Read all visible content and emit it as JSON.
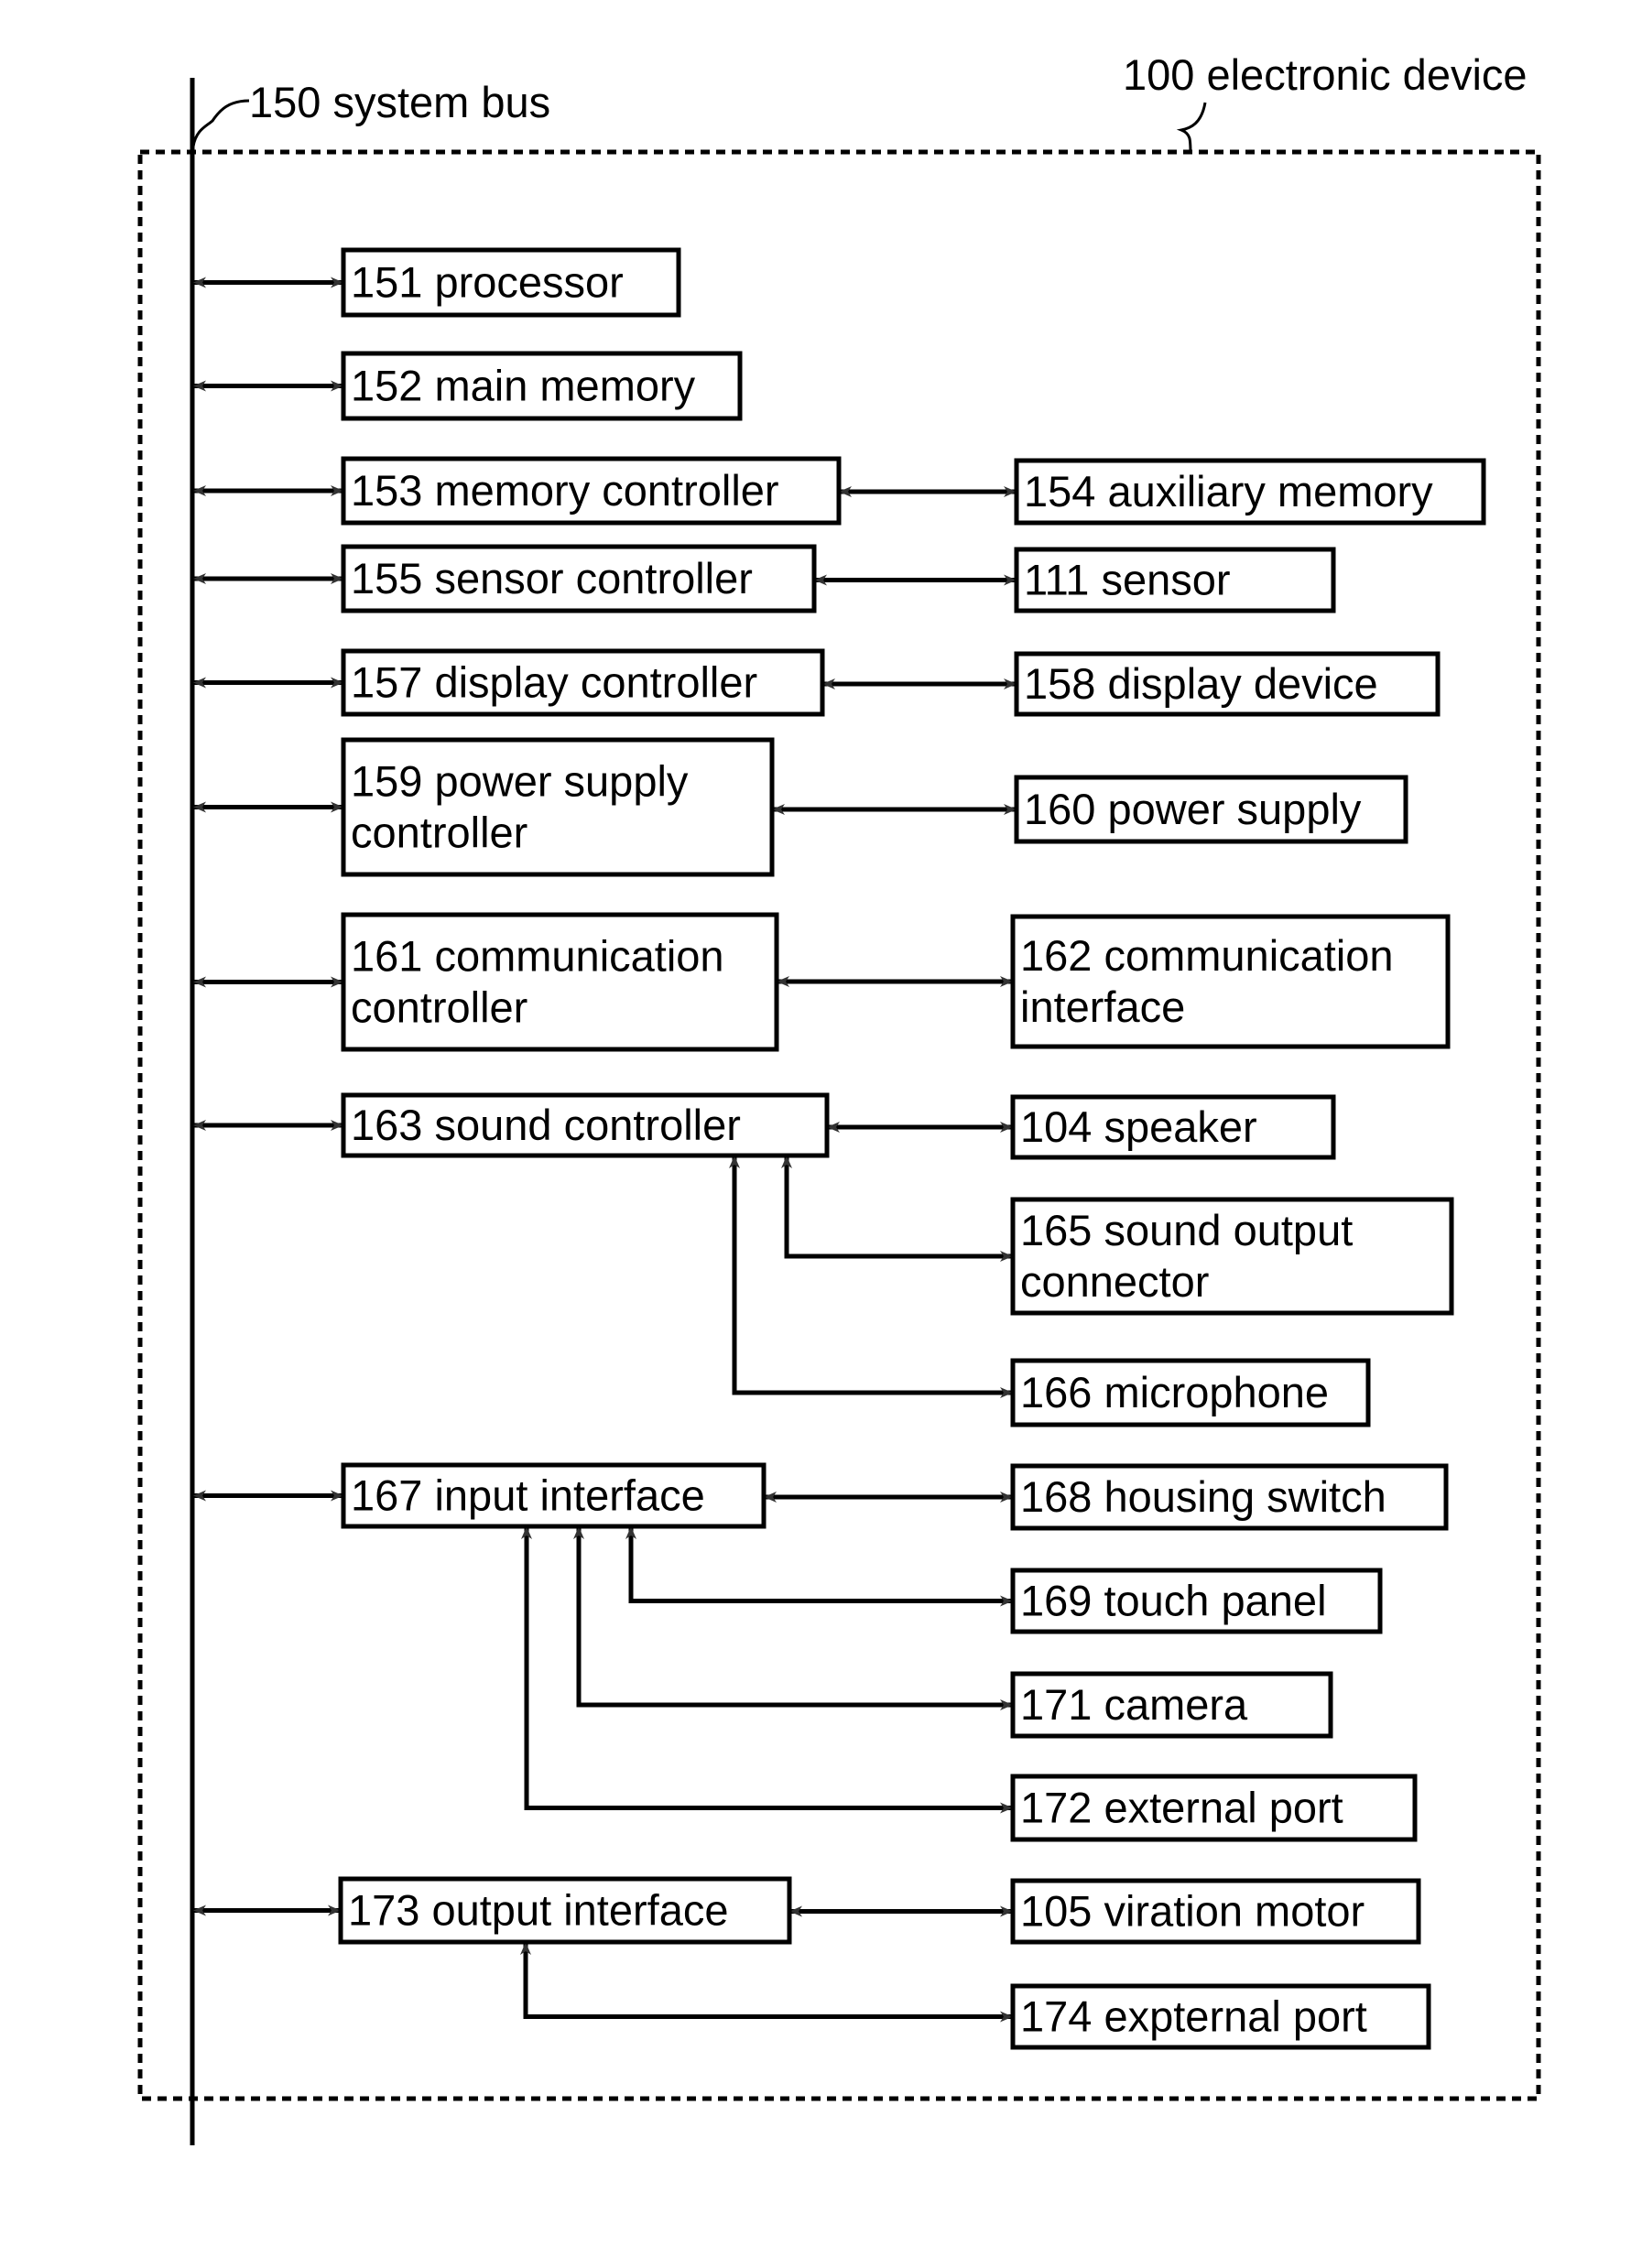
{
  "figure": {
    "device_label": "100 electronic device",
    "bus_label": "150 system bus",
    "bus_connected": [
      "151",
      "152",
      "153",
      "155",
      "157",
      "159",
      "161",
      "163",
      "167",
      "173"
    ],
    "blocks": [
      {
        "id": "151",
        "lines": [
          "151 processor"
        ]
      },
      {
        "id": "152",
        "lines": [
          "152 main memory"
        ]
      },
      {
        "id": "153",
        "lines": [
          "153 memory controller"
        ]
      },
      {
        "id": "154",
        "lines": [
          "154 auxiliary memory"
        ]
      },
      {
        "id": "155",
        "lines": [
          "155 sensor controller"
        ]
      },
      {
        "id": "111",
        "lines": [
          "111 sensor"
        ]
      },
      {
        "id": "157",
        "lines": [
          "157 display controller"
        ]
      },
      {
        "id": "158",
        "lines": [
          "158 display device"
        ]
      },
      {
        "id": "159",
        "lines": [
          "159 power supply",
          "controller"
        ]
      },
      {
        "id": "160",
        "lines": [
          "160 power supply"
        ]
      },
      {
        "id": "161",
        "lines": [
          "161 communication",
          "controller"
        ]
      },
      {
        "id": "162",
        "lines": [
          "162 communication",
          "interface"
        ]
      },
      {
        "id": "163",
        "lines": [
          "163 sound controller"
        ]
      },
      {
        "id": "104",
        "lines": [
          "104 speaker"
        ]
      },
      {
        "id": "165",
        "lines": [
          "165 sound output",
          "connector"
        ]
      },
      {
        "id": "166",
        "lines": [
          "166 microphone"
        ]
      },
      {
        "id": "167",
        "lines": [
          "167 input interface"
        ]
      },
      {
        "id": "168",
        "lines": [
          "168 housing switch"
        ]
      },
      {
        "id": "169",
        "lines": [
          "169 touch panel"
        ]
      },
      {
        "id": "171",
        "lines": [
          "171 camera"
        ]
      },
      {
        "id": "172",
        "lines": [
          "172 external port"
        ]
      },
      {
        "id": "173",
        "lines": [
          "173 output interface"
        ]
      },
      {
        "id": "105",
        "lines": [
          "105 viration motor"
        ]
      },
      {
        "id": "174",
        "lines": [
          "174 expternal port"
        ]
      }
    ],
    "connections": [
      {
        "from": "153",
        "to": "154",
        "type": "bidirectional"
      },
      {
        "from": "155",
        "to": "111",
        "type": "bidirectional"
      },
      {
        "from": "157",
        "to": "158",
        "type": "bidirectional"
      },
      {
        "from": "159",
        "to": "160",
        "type": "bidirectional"
      },
      {
        "from": "161",
        "to": "162",
        "type": "bidirectional"
      },
      {
        "from": "163",
        "to": "104",
        "type": "bidirectional"
      },
      {
        "from": "163",
        "to": "165",
        "type": "bidirectional"
      },
      {
        "from": "163",
        "to": "166",
        "type": "bidirectional"
      },
      {
        "from": "167",
        "to": "168",
        "type": "bidirectional"
      },
      {
        "from": "167",
        "to": "169",
        "type": "bidirectional"
      },
      {
        "from": "167",
        "to": "171",
        "type": "bidirectional"
      },
      {
        "from": "167",
        "to": "172",
        "type": "bidirectional"
      },
      {
        "from": "173",
        "to": "105",
        "type": "bidirectional"
      },
      {
        "from": "173",
        "to": "174",
        "type": "bidirectional"
      }
    ]
  }
}
